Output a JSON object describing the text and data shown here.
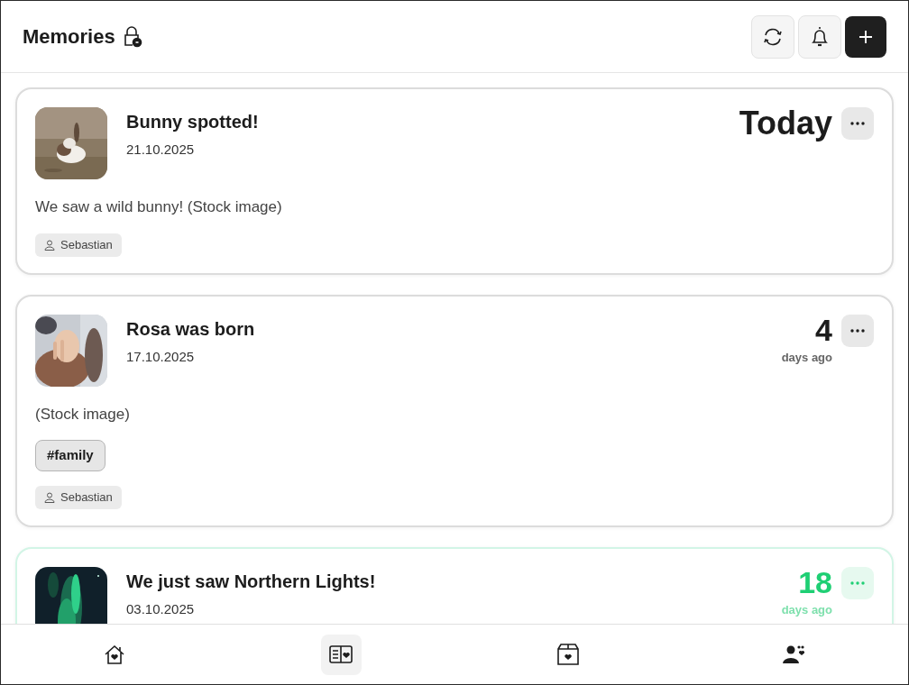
{
  "header": {
    "title": "Memories"
  },
  "memories": [
    {
      "title": "Bunny spotted!",
      "date": "21.10.2025",
      "when": "Today",
      "description": "We saw a wild bunny! (Stock image)",
      "author": "Sebastian",
      "highlighted": false
    },
    {
      "title": "Rosa was born",
      "date": "17.10.2025",
      "when": "4",
      "when_unit": "days ago",
      "description": "(Stock image)",
      "tags": [
        "#family"
      ],
      "author": "Sebastian",
      "highlighted": false
    },
    {
      "title": "We just saw Northern Lights!",
      "date": "03.10.2025",
      "when": "18",
      "when_unit": "days ago",
      "highlighted": true
    }
  ],
  "nav": [
    {
      "selected": false
    },
    {
      "selected": true
    },
    {
      "selected": false
    },
    {
      "selected": false
    }
  ]
}
